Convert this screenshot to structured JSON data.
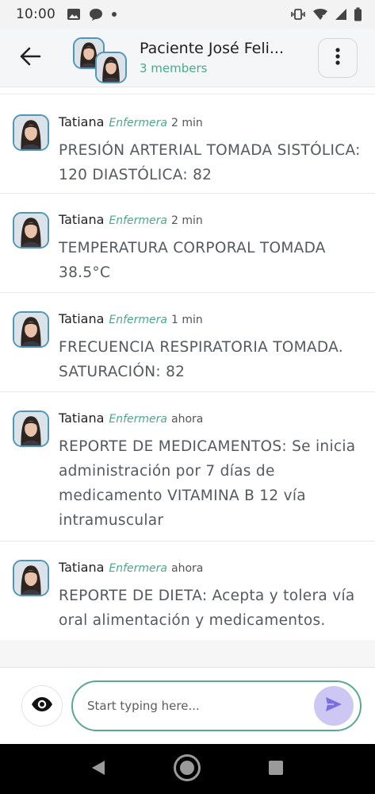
{
  "status_bar": {
    "time": "10:00",
    "icons": [
      "image-icon",
      "message-icon",
      "dot-icon",
      "vibrate-icon",
      "wifi-icon",
      "signal-icon",
      "battery-icon"
    ]
  },
  "header": {
    "title": "Paciente José Feli...",
    "subtitle": "3 members",
    "icons": [
      "back-arrow-icon",
      "more-vert-icon"
    ]
  },
  "messages": [
    {
      "sender": "Tatiana",
      "role": "Enfermera",
      "time": "2 min",
      "text": "PRESIÓN ARTERIAL TOMADA SISTÓLICA: 120 DIASTÓLICA: 82"
    },
    {
      "sender": "Tatiana",
      "role": "Enfermera",
      "time": "2 min",
      "text": "TEMPERATURA CORPORAL TOMADA 38.5°C"
    },
    {
      "sender": "Tatiana",
      "role": "Enfermera",
      "time": "1 min",
      "text": "FRECUENCIA RESPIRATORIA TOMADA. SATURACIÓN:  82"
    },
    {
      "sender": "Tatiana",
      "role": "Enfermera",
      "time": "ahora",
      "text": "REPORTE DE MEDICAMENTOS: Se inicia administración  por 7 días de medicamento VITAMINA B 12  vía intramuscular"
    },
    {
      "sender": "Tatiana",
      "role": "Enfermera",
      "time": "ahora",
      "text": "REPORTE DE DIETA: Acepta y tolera vía oral alimentación y medicamentos."
    }
  ],
  "composer": {
    "placeholder": "Start typing here...",
    "icons": [
      "eye-icon",
      "send-icon"
    ]
  },
  "nav_bar": {
    "icons": [
      "nav-back-icon",
      "nav-home-icon",
      "nav-recents-icon"
    ]
  },
  "colors": {
    "accent_green": "#4aa989",
    "avatar_border": "#4f97b8",
    "send_button": "#cdc7f3",
    "send_icon": "#7b6fe0"
  }
}
